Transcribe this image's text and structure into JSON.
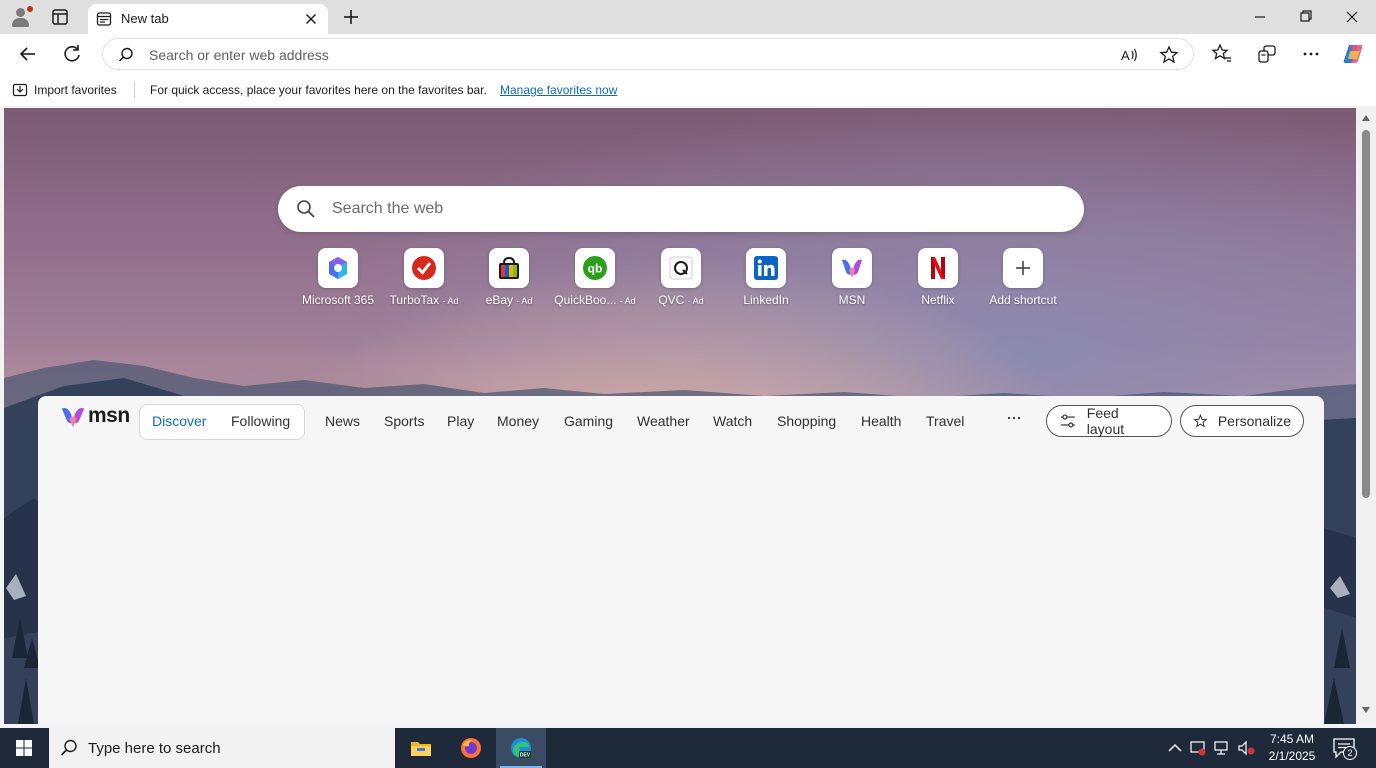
{
  "browser": {
    "tab_title": "New tab",
    "address_placeholder": "Search or enter web address"
  },
  "favorites_bar": {
    "import_label": "Import favorites",
    "message": "For quick access, place your favorites here on the favorites bar.",
    "manage_link": "Manage favorites now"
  },
  "new_tab_page": {
    "search_placeholder": "Search the web",
    "shortcuts": [
      {
        "label": "Microsoft 365",
        "ad": "",
        "icon": "microsoft-365-icon"
      },
      {
        "label": "TurboTax",
        "ad": "· Ad",
        "icon": "turbotax-icon"
      },
      {
        "label": "eBay",
        "ad": "· Ad",
        "icon": "ebay-icon"
      },
      {
        "label": "QuickBoo...",
        "ad": "· Ad",
        "icon": "quickbooks-icon"
      },
      {
        "label": "QVC",
        "ad": "· Ad",
        "icon": "qvc-icon"
      },
      {
        "label": "LinkedIn",
        "ad": "",
        "icon": "linkedin-icon"
      },
      {
        "label": "MSN",
        "ad": "",
        "icon": "msn-icon"
      },
      {
        "label": "Netflix",
        "ad": "",
        "icon": "netflix-icon"
      },
      {
        "label": "Add shortcut",
        "ad": "",
        "icon": "plus-icon"
      }
    ]
  },
  "feed": {
    "logo_text": "msn",
    "tabs": {
      "discover": "Discover",
      "following": "Following"
    },
    "nav": [
      "News",
      "Sports",
      "Play",
      "Money",
      "Gaming",
      "Weather",
      "Watch",
      "Shopping",
      "Health",
      "Travel"
    ],
    "feed_layout_label": "Feed layout",
    "personalize_label": "Personalize"
  },
  "taskbar": {
    "search_placeholder": "Type here to search",
    "time": "7:45 AM",
    "date": "2/1/2025",
    "notification_count": "2"
  },
  "colors": {
    "accent": "#0f6cbd",
    "taskbar": "#1e2a3a"
  }
}
